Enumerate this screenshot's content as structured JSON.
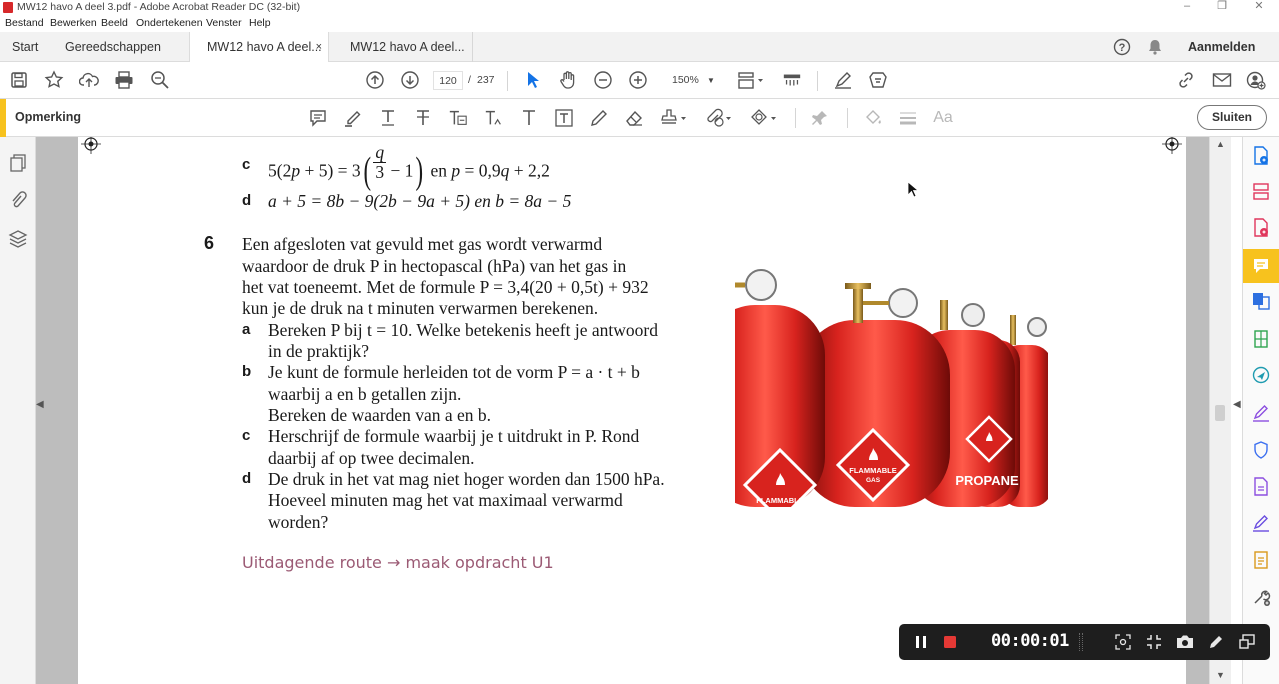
{
  "window": {
    "title": "MW12 havo A deel 3.pdf - Adobe Acrobat Reader DC (32-bit)",
    "controls": [
      "–",
      "❐",
      "✕"
    ]
  },
  "menu": [
    "Bestand",
    "Bewerken",
    "Beeld",
    "Ondertekenen",
    "Venster",
    "Help"
  ],
  "tabs": {
    "start": "Start",
    "tools": "Gereedschappen",
    "doc1": "MW12 havo A deel...",
    "doc2": "MW12 havo A deel...",
    "close": "×",
    "signin": "Aanmelden"
  },
  "toolbar": {
    "page_current": "120",
    "page_sep": "/",
    "page_total": "237",
    "zoom": "150%"
  },
  "commentbar": {
    "label": "Opmerking",
    "close": "Sluiten"
  },
  "document": {
    "item_c_label": "c",
    "item_c_text": "5(2p + 5) = 3(q/3 − 1) en p = 0,9q + 2,2",
    "item_c_part1": "5(2",
    "item_c_var_p": "p",
    "item_c_part2": " + 5) = 3",
    "item_c_frac_num": "q",
    "item_c_frac_den": "3",
    "item_c_part3": " − 1",
    "item_c_part4": " en ",
    "item_c_part5": "p",
    "item_c_part6": " = 0,9",
    "item_c_part7": "q",
    "item_c_part8": " + 2,2",
    "item_d_label": "d",
    "item_d_text": "a + 5 = 8b − 9(2b − 9a + 5) en b = 8a − 5",
    "q6_number": "6",
    "q6_lines": [
      "Een afgesloten vat gevuld met gas wordt verwarmd",
      "waardoor de druk P in hectopascal (hPa) van het gas in",
      "het vat toeneemt. Met de formule P = 3,4(20 + 0,5t) + 932",
      "kun je de druk na t minuten verwarmen berekenen."
    ],
    "q6a_label": "a",
    "q6a_lines": [
      "Bereken P bij t = 10. Welke betekenis heeft je antwoord",
      "in de praktijk?"
    ],
    "q6b_label": "b",
    "q6b_lines": [
      "Je kunt de formule herleiden tot de vorm P = a · t + b",
      "waarbij a en b getallen zijn.",
      "Bereken de waarden van a en b."
    ],
    "q6c_label": "c",
    "q6c_lines": [
      "Herschrijf de formule waarbij je t uitdrukt in P. Rond",
      "daarbij af op twee decimalen."
    ],
    "q6d_label": "d",
    "q6d_lines": [
      "De druk in het vat mag niet hoger worden dan 1500 hPa.",
      "Hoeveel minuten mag het vat maximaal verwarmd",
      "worden?"
    ],
    "challenge": "Uitdagende route → maak opdracht U1",
    "image": {
      "labels": [
        "FLAMMABLE GAS",
        "PROPANE",
        "FLAMMABLE"
      ],
      "label_flammable_gas_1": "FLAMMABLE",
      "label_flammable_gas_2": "GAS",
      "label_propane": "PROPANE",
      "label_flammable_left": "FLAMMABLE"
    }
  },
  "recorder": {
    "time": "00:00:01"
  },
  "colors": {
    "accent_yellow": "#f7c21e",
    "challenge_text": "#9b5a74",
    "acrobat_red": "#d6282a",
    "cylinder_red": "#d8231e"
  }
}
